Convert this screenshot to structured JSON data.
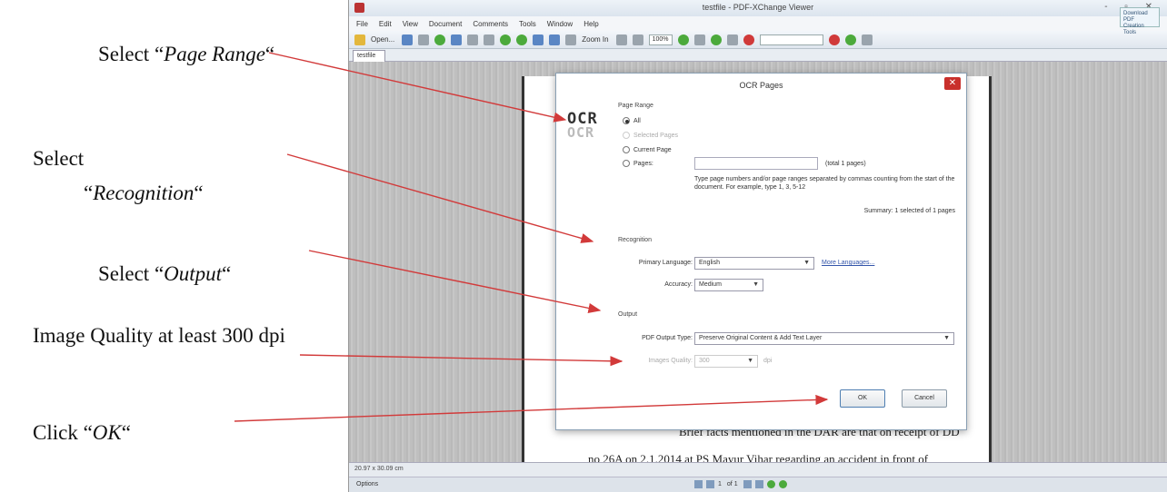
{
  "captions": {
    "page_range": {
      "prefix": "Select “",
      "emph": "Page Range",
      "suffix": "“"
    },
    "recognition": {
      "line1": "Select",
      "open": "“",
      "emph": "Recognition",
      "suffix": "“"
    },
    "output": {
      "prefix": "Select “",
      "emph": "Output",
      "suffix": "“"
    },
    "image_quality": "Image Quality at least 300 dpi",
    "click_ok": {
      "prefix": "Click “",
      "emph": "OK",
      "suffix": "“"
    }
  },
  "window": {
    "title": "testfile - PDF-XChange Viewer",
    "controls": "- ▫ ✕",
    "promo": "Download PDF Creation Tools"
  },
  "menu": [
    "File",
    "Edit",
    "View",
    "Document",
    "Comments",
    "Tools",
    "Window",
    "Help"
  ],
  "toolbar": {
    "open_label": "Open...",
    "zoom_in_label": "Zoom In",
    "zoom_value": "100%"
  },
  "tab": {
    "label": "testfile"
  },
  "document": {
    "line1": "Brief facts mentioned in the DAR are that on receipt of DD",
    "line2": "no 26A on 2.1.2014 at PS Mayur Vihar regarding an accident in front of"
  },
  "statusbar": {
    "size": "20.97 x 30.09 cm",
    "options": "Options",
    "page_current": "1",
    "page_total": "of 1"
  },
  "dialog": {
    "title": "OCR Pages",
    "close": "✕",
    "logo_top": "OCR",
    "logo_bottom": "OCR",
    "page_range": {
      "heading": "Page Range",
      "all": "All",
      "selected_pages": "Selected Pages",
      "current_page": "Current Page",
      "pages": "Pages:",
      "total": "(total 1 pages)",
      "hint": "Type page numbers and/or page ranges separated by commas counting from the start of the document. For example, type 1, 3, 5-12",
      "summary": "Summary: 1 selected of 1 pages"
    },
    "recognition": {
      "heading": "Recognition",
      "language_label": "Primary Language:",
      "language_value": "English",
      "more_languages": "More Languages...",
      "accuracy_label": "Accuracy:",
      "accuracy_value": "Medium"
    },
    "output": {
      "heading": "Output",
      "pdf_type_label": "PDF Output Type:",
      "pdf_type_value": "Preserve Original Content & Add Text Layer",
      "image_quality_label": "Images Quality:",
      "image_quality_value": "300",
      "image_quality_unit": "dpi"
    },
    "ok_label": "OK",
    "cancel_label": "Cancel"
  },
  "colors": {
    "arrow": "#d23a3a",
    "close_button": "#c9302c",
    "link": "#3355aa"
  }
}
